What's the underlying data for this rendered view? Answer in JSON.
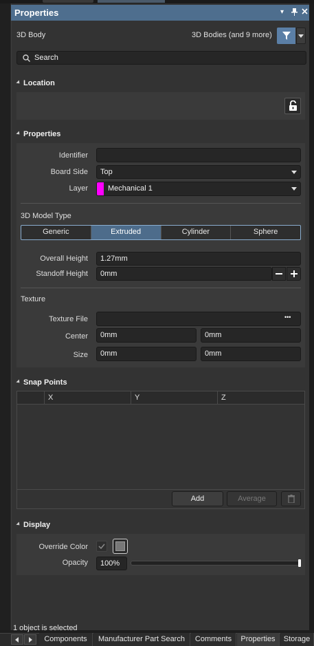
{
  "panel": {
    "title": "Properties",
    "title_controls": [
      "▾",
      "✚",
      "✕"
    ],
    "object_type": "3D Body",
    "filter_text": "3D Bodies (and 9 more)",
    "search_placeholder": "Search"
  },
  "location": {
    "header": "Location"
  },
  "properties": {
    "header": "Properties",
    "identifier_label": "Identifier",
    "identifier_value": "",
    "board_side_label": "Board Side",
    "board_side_value": "Top",
    "layer_label": "Layer",
    "layer_value": "Mechanical 1",
    "layer_color": "#ff00ff",
    "model_type_label": "3D Model Type",
    "model_types": [
      "Generic",
      "Extruded",
      "Cylinder",
      "Sphere"
    ],
    "model_type_selected": "Extruded",
    "overall_height_label": "Overall Height",
    "overall_height_value": "1.27mm",
    "standoff_height_label": "Standoff Height",
    "standoff_height_value": "0mm",
    "texture_label": "Texture",
    "texture_file_label": "Texture File",
    "texture_file_value": "",
    "texture_more": "•••",
    "center_label": "Center",
    "center_x": "0mm",
    "center_y": "0mm",
    "size_label": "Size",
    "size_x": "0mm",
    "size_y": "0mm"
  },
  "snap_points": {
    "header": "Snap Points",
    "columns": [
      "",
      "X",
      "Y",
      "Z"
    ],
    "rows": [],
    "add_label": "Add",
    "average_label": "Average"
  },
  "display": {
    "header": "Display",
    "override_color_label": "Override Color",
    "override_color_checked": true,
    "override_swatch": "#777777",
    "opacity_label": "Opacity",
    "opacity_value": "100%",
    "opacity_level": 1.0
  },
  "status": {
    "text": "1 object is selected"
  },
  "tabs": [
    "Components",
    "Manufacturer Part Search",
    "Comments",
    "Properties",
    "Storage"
  ],
  "tabs_active": "Properties",
  "colors": {
    "title_bar": "#4e6e8e",
    "accent": "#4d6c8b",
    "filter_button": "#5b7fa6"
  }
}
